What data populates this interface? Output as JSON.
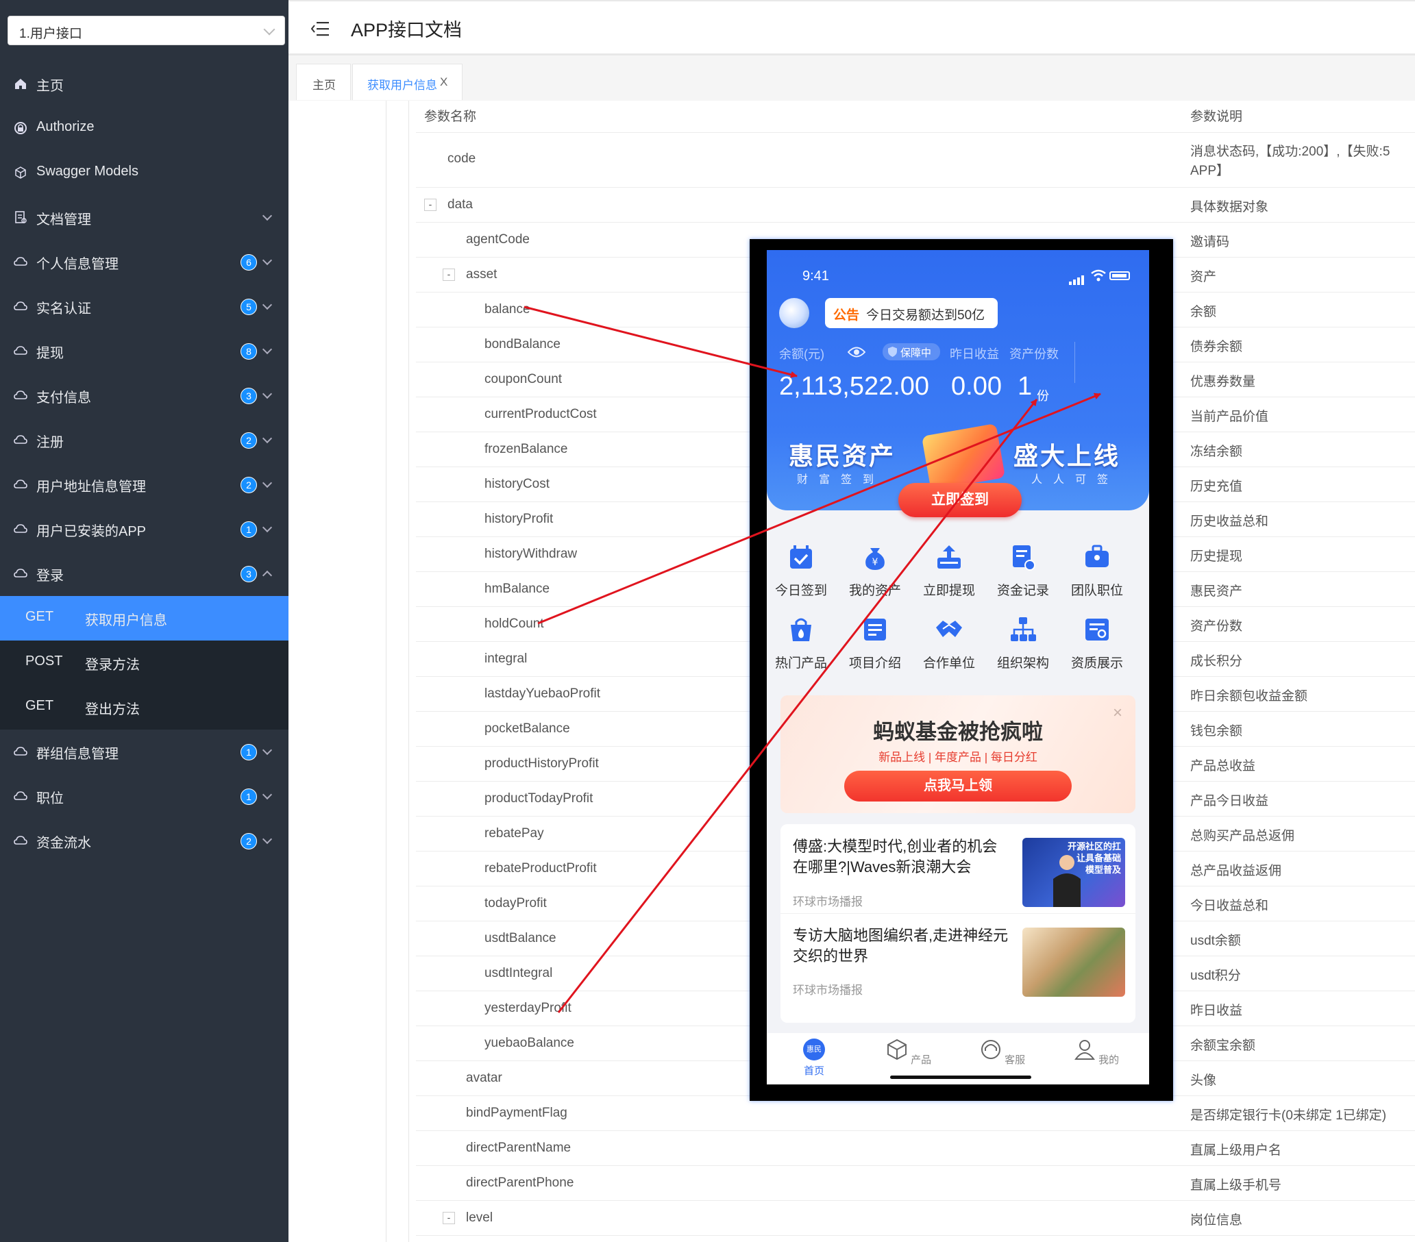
{
  "sidebar": {
    "select_value": "1.用户接口",
    "items": [
      {
        "label": "主页",
        "badge": ""
      },
      {
        "label": "Authorize",
        "badge": ""
      },
      {
        "label": "Swagger Models",
        "badge": ""
      },
      {
        "label": "文档管理",
        "badge": ""
      },
      {
        "label": "个人信息管理",
        "badge": "6"
      },
      {
        "label": "实名认证",
        "badge": "5"
      },
      {
        "label": "提现",
        "badge": "8"
      },
      {
        "label": "支付信息",
        "badge": "3"
      },
      {
        "label": "注册",
        "badge": "2"
      },
      {
        "label": "用户地址信息管理",
        "badge": "2"
      },
      {
        "label": "用户已安装的APP",
        "badge": "1"
      },
      {
        "label": "登录",
        "badge": "3"
      },
      {
        "label": "群组信息管理",
        "badge": "1"
      },
      {
        "label": "职位",
        "badge": "1"
      },
      {
        "label": "资金流水",
        "badge": "2"
      }
    ],
    "sub_items": [
      {
        "method": "GET",
        "label": "获取用户信息"
      },
      {
        "method": "POST",
        "label": "登录方法"
      },
      {
        "method": "GET",
        "label": "登出方法"
      }
    ]
  },
  "header": {
    "title": "APP接口文档"
  },
  "tabs": [
    {
      "label": "主页"
    },
    {
      "label": "获取用户信息",
      "close": "X"
    }
  ],
  "table": {
    "col_name": "参数名称",
    "col_desc": "参数说明",
    "rows": [
      {
        "name": "code",
        "desc": "消息状态码,【成功:200】,【失败:5",
        "desc2": "APP】"
      },
      {
        "name": "data",
        "desc": "具体数据对象",
        "toggle": "-"
      },
      {
        "name": "agentCode",
        "desc": "邀请码"
      },
      {
        "name": "asset",
        "desc": "资产",
        "toggle": "-"
      },
      {
        "name": "balance",
        "desc": "余额"
      },
      {
        "name": "bondBalance",
        "desc": "债券余额"
      },
      {
        "name": "couponCount",
        "desc": "优惠券数量"
      },
      {
        "name": "currentProductCost",
        "desc": "当前产品价值"
      },
      {
        "name": "frozenBalance",
        "desc": "冻结余额"
      },
      {
        "name": "historyCost",
        "desc": "历史充值"
      },
      {
        "name": "historyProfit",
        "desc": "历史收益总和"
      },
      {
        "name": "historyWithdraw",
        "desc": "历史提现"
      },
      {
        "name": "hmBalance",
        "desc": "惠民资产"
      },
      {
        "name": "holdCount",
        "desc": "资产份数"
      },
      {
        "name": "integral",
        "desc": "成长积分"
      },
      {
        "name": "lastdayYuebaoProfit",
        "desc": "昨日余额包收益金额"
      },
      {
        "name": "pocketBalance",
        "desc": "钱包余额"
      },
      {
        "name": "productHistoryProfit",
        "desc": "产品总收益"
      },
      {
        "name": "productTodayProfit",
        "desc": "产品今日收益"
      },
      {
        "name": "rebatePay",
        "desc": "总购买产品总返佣"
      },
      {
        "name": "rebateProductProfit",
        "desc": "总产品收益返佣"
      },
      {
        "name": "todayProfit",
        "desc": "今日收益总和"
      },
      {
        "name": "usdtBalance",
        "desc": "usdt余额"
      },
      {
        "name": "usdtIntegral",
        "desc": "usdt积分"
      },
      {
        "name": "yesterdayProfit",
        "desc": "昨日收益"
      },
      {
        "name": "yuebaoBalance",
        "desc": "余额宝余额"
      },
      {
        "name": "avatar",
        "desc": "头像"
      },
      {
        "name": "bindPaymentFlag",
        "desc": "是否绑定银行卡(0未绑定 1已绑定)"
      },
      {
        "name": "directParentName",
        "desc": "直属上级用户名"
      },
      {
        "name": "directParentPhone",
        "desc": "直属上级手机号"
      },
      {
        "name": "level",
        "desc": "岗位信息",
        "toggle": "-"
      }
    ]
  },
  "phone": {
    "time": "9:41",
    "notice_tag": "公告",
    "notice_text": "今日交易额达到50亿",
    "balance_label": "余额(元)",
    "protect_label": "保障中",
    "yesterday_label": "昨日收益",
    "shares_label": "资产份数",
    "balance_value": "2,113,522.00",
    "yesterday_value": "0.00",
    "shares_value": "1",
    "shares_unit": "份",
    "banner_left": "惠民资产",
    "banner_left_sub": "财富签到",
    "banner_right": "盛大上线",
    "banner_right_sub": "人人可签",
    "signin_button": "立即签到",
    "grid": [
      {
        "label": "今日签到",
        "icon": "calendar-check-icon"
      },
      {
        "label": "我的资产",
        "icon": "money-bag-icon"
      },
      {
        "label": "立即提现",
        "icon": "withdraw-icon"
      },
      {
        "label": "资金记录",
        "icon": "record-icon"
      },
      {
        "label": "团队职位",
        "icon": "briefcase-icon"
      },
      {
        "label": "热门产品",
        "icon": "hot-bag-icon"
      },
      {
        "label": "项目介绍",
        "icon": "doc-icon"
      },
      {
        "label": "合作单位",
        "icon": "handshake-icon"
      },
      {
        "label": "组织架构",
        "icon": "org-chart-icon"
      },
      {
        "label": "资质展示",
        "icon": "certificate-icon"
      }
    ],
    "promo_title": "蚂蚁基金被抢疯啦",
    "promo_tags": "新品上线 | 年度产品 | 每日分红",
    "promo_button": "点我马上领",
    "promo_close": "×",
    "news": [
      {
        "title": "傅盛:大模型时代,创业者的机会在哪里?|Waves新浪潮大会",
        "source": "环球市场播报",
        "img_text": "开源社区的扛\n让具备基础\n模型普及"
      },
      {
        "title": "专访大脑地图编织者,走进神经元交织的世界",
        "source": "环球市场播报"
      }
    ],
    "tabbar": [
      {
        "label": "首页",
        "badge": "惠民"
      },
      {
        "label": "产品"
      },
      {
        "label": "客服"
      },
      {
        "label": "我的"
      }
    ]
  },
  "colors": {
    "accent": "#3c8dff",
    "sidebar": "#2b333e",
    "arrow": "#e0141e",
    "badge": "#1890ff"
  }
}
